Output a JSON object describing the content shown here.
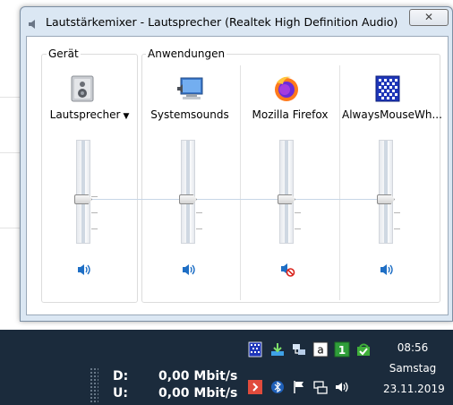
{
  "window": {
    "title": "Lautstärkemixer - Lautsprecher (Realtek High Definition Audio)",
    "close_glyph": "✕"
  },
  "device_group": {
    "label": "Gerät",
    "device": {
      "name": "Lautsprecher",
      "icon": "speaker-device-icon",
      "volume_percent": 50,
      "muted": false
    }
  },
  "apps_group": {
    "label": "Anwendungen",
    "apps": [
      {
        "name": "Systemsounds",
        "icon": "system-sounds-icon",
        "volume_percent": 50,
        "muted": false
      },
      {
        "name": "Mozilla Firefox",
        "icon": "firefox-icon",
        "volume_percent": 50,
        "muted": true
      },
      {
        "name": "AlwaysMouseWh...",
        "icon": "alwaysmousewheel-icon",
        "volume_percent": 50,
        "muted": false
      }
    ]
  },
  "taskbar": {
    "net_download_label": "D:",
    "net_download_value": "0,00 Mbit/s",
    "net_upload_label": "U:",
    "net_upload_value": "0,00 Mbit/s",
    "tray_a_letter": "a",
    "tray_one_digit": "1",
    "clock_time": "08:56",
    "clock_day": "Samstag",
    "clock_date": "23.11.2019"
  },
  "colors": {
    "window_frame": "#dbe7f3",
    "taskbar": "#1b2b3c",
    "speaker_blue": "#1f6fc5",
    "mute_red": "#d9231c",
    "firefox_orange": "#ff7a1c"
  }
}
